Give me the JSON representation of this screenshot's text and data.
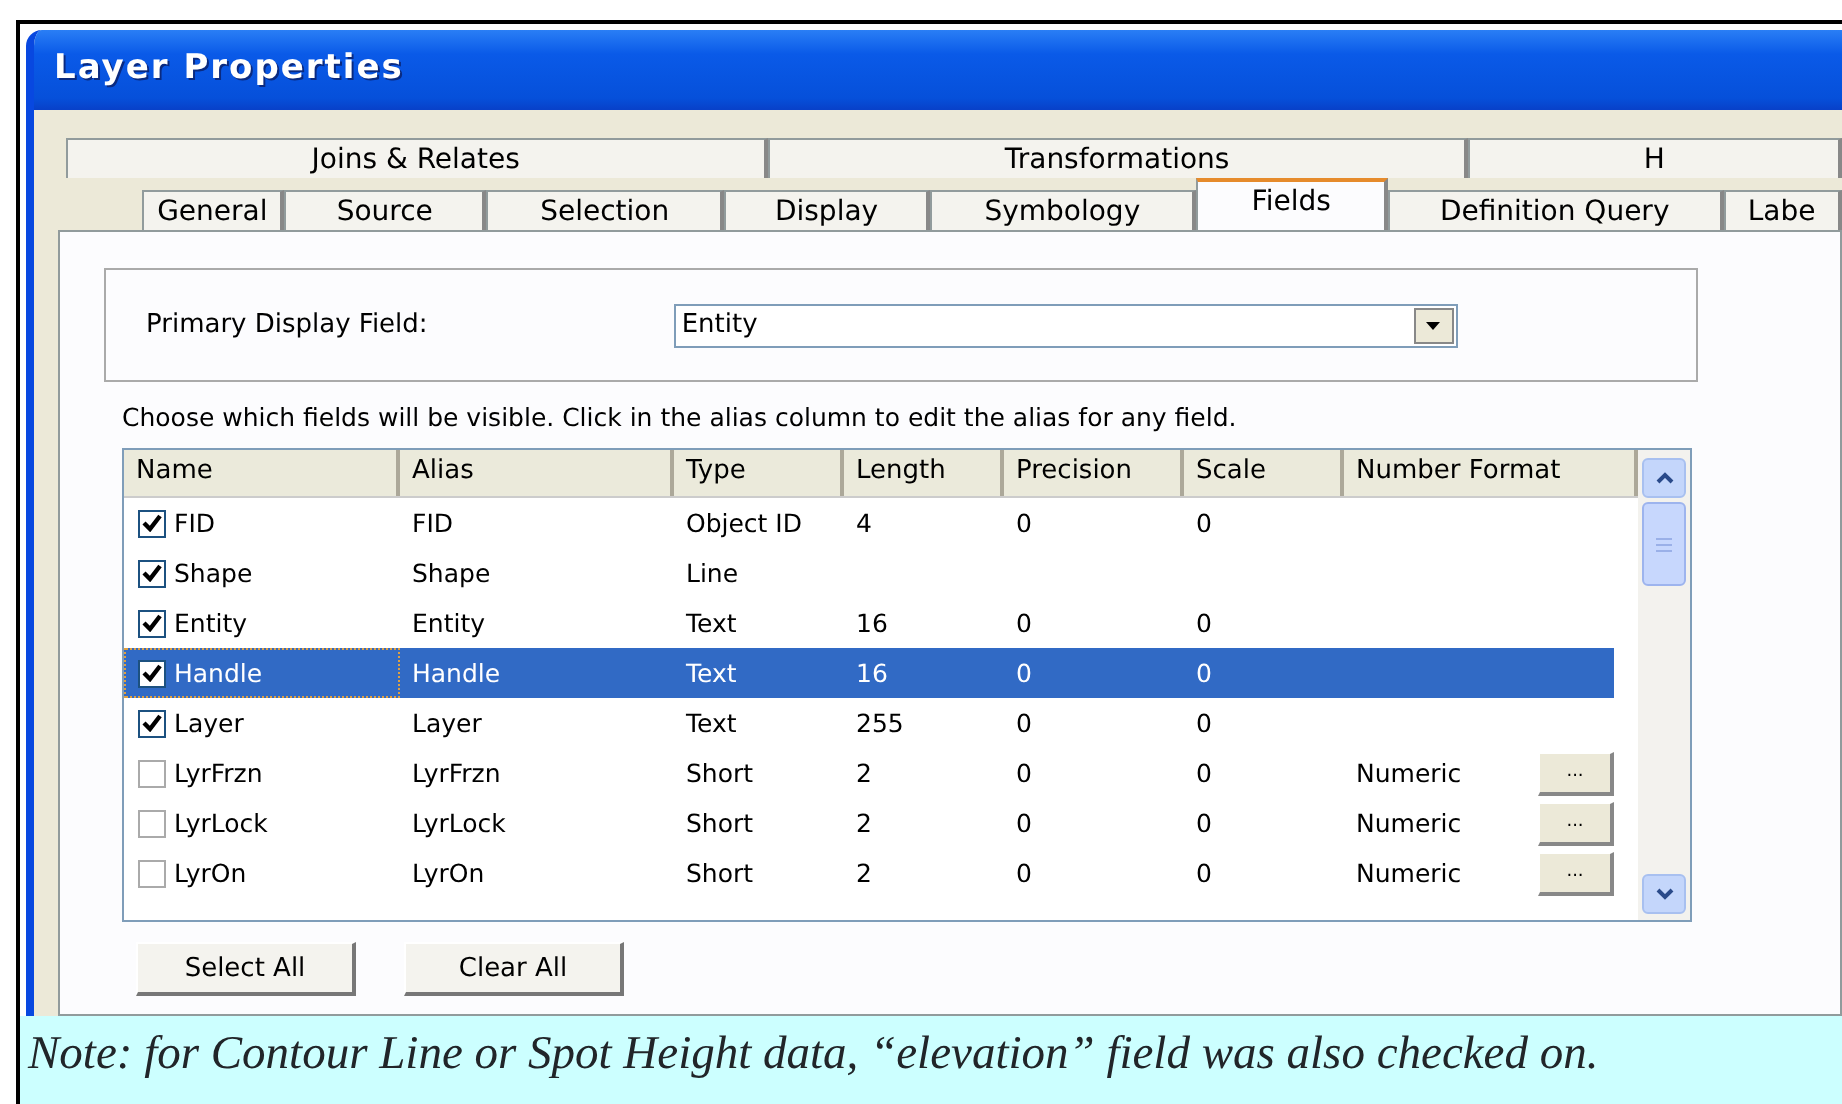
{
  "window": {
    "title": "Layer Properties"
  },
  "tab_rows": [
    [
      {
        "label": "Joins & Relates",
        "selected": false
      },
      {
        "label": "Transformations",
        "selected": false
      },
      {
        "label": "H",
        "selected": false
      }
    ],
    [
      {
        "label": "General",
        "selected": false
      },
      {
        "label": "Source",
        "selected": false
      },
      {
        "label": "Selection",
        "selected": false
      },
      {
        "label": "Display",
        "selected": false
      },
      {
        "label": "Symbology",
        "selected": false
      },
      {
        "label": "Fields",
        "selected": true
      },
      {
        "label": "Definition Query",
        "selected": false
      },
      {
        "label": "Labe",
        "selected": false
      }
    ]
  ],
  "primary_display_field": {
    "label": "Primary Display Field:",
    "value": "Entity"
  },
  "instructions": "Choose which fields will be visible. Click in the alias column to edit the alias for any field.",
  "table": {
    "columns": [
      "Name",
      "Alias",
      "Type",
      "Length",
      "Precision",
      "Scale",
      "Number Format"
    ],
    "rows": [
      {
        "name": "FID",
        "alias": "FID",
        "type": "Object ID",
        "length": "4",
        "precision": "0",
        "scale": "0",
        "checked": true,
        "selected": false
      },
      {
        "name": "Shape",
        "alias": "Shape",
        "type": "Line",
        "checked": true,
        "selected": false
      },
      {
        "name": "Entity",
        "alias": "Entity",
        "type": "Text",
        "length": "16",
        "precision": "0",
        "scale": "0",
        "checked": true,
        "selected": false
      },
      {
        "name": "Handle",
        "alias": "Handle",
        "type": "Text",
        "length": "16",
        "precision": "0",
        "scale": "0",
        "checked": true,
        "selected": true
      },
      {
        "name": "Layer",
        "alias": "Layer",
        "type": "Text",
        "length": "255",
        "precision": "0",
        "scale": "0",
        "checked": true,
        "selected": false
      },
      {
        "name": "LyrFrzn",
        "alias": "LyrFrzn",
        "type": "Short",
        "length": "2",
        "precision": "0",
        "scale": "0",
        "number_format": "Numeric",
        "format_button": "...",
        "checked": false,
        "selected": false
      },
      {
        "name": "LyrLock",
        "alias": "LyrLock",
        "type": "Short",
        "length": "2",
        "precision": "0",
        "scale": "0",
        "number_format": "Numeric",
        "format_button": "...",
        "checked": false,
        "selected": false
      },
      {
        "name": "LyrOn",
        "alias": "LyrOn",
        "type": "Short",
        "length": "2",
        "precision": "0",
        "scale": "0",
        "number_format": "Numeric",
        "format_button": "...",
        "checked": false,
        "selected": false
      }
    ]
  },
  "buttons": [
    "Select All",
    "Clear All"
  ],
  "note": "Note: for Contour Line or Spot Height data, “elevation” field was also checked on."
}
